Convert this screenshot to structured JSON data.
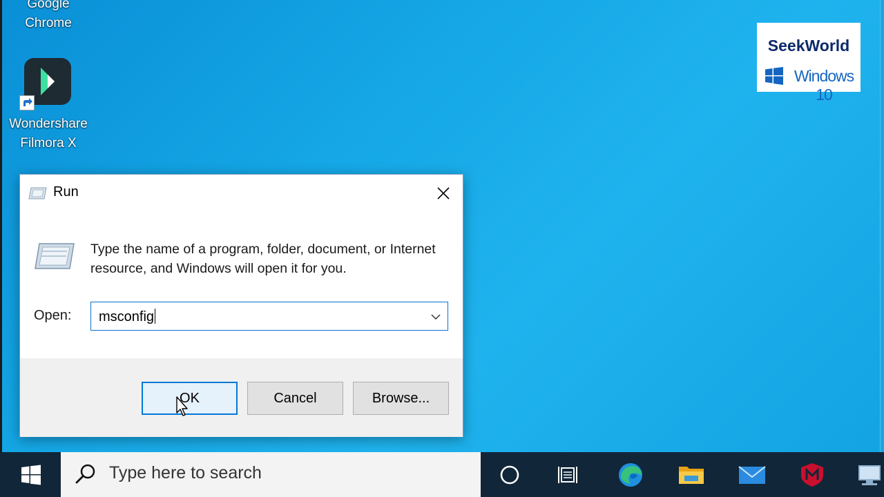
{
  "desktop": {
    "icons": [
      {
        "label": "Google\nChrome"
      },
      {
        "label": "Wondershare\nFilmora X"
      }
    ]
  },
  "watermark": {
    "brand": "SeekWorld",
    "os": "Windows 10"
  },
  "run_dialog": {
    "title": "Run",
    "description": "Type the name of a program, folder, document, or Internet resource, and Windows will open it for you.",
    "open_label": "Open:",
    "open_value": "msconfig",
    "buttons": {
      "ok": "OK",
      "cancel": "Cancel",
      "browse": "Browse..."
    }
  },
  "taskbar": {
    "search_placeholder": "Type here to search",
    "icons": [
      "cortana-icon",
      "task-view-icon",
      "edge-icon",
      "file-explorer-icon",
      "mail-icon",
      "mcafee-icon",
      "network-icon"
    ]
  },
  "colors": {
    "desktop_blue": "#15a7e6",
    "taskbar": "#112638",
    "accent": "#0078d7"
  }
}
